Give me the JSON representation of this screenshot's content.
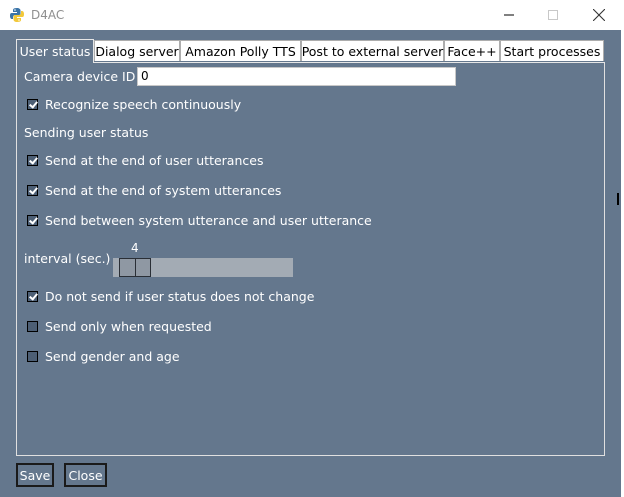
{
  "window": {
    "title": "D4AC"
  },
  "tabs": [
    {
      "label": "User status"
    },
    {
      "label": "Dialog server"
    },
    {
      "label": "Amazon Polly TTS"
    },
    {
      "label": "Post to external server"
    },
    {
      "label": "Face++"
    },
    {
      "label": "Start processes"
    }
  ],
  "user_status": {
    "camera_label": "Camera device ID",
    "camera_value": "0",
    "recognize_label": "Recognize speech continuously",
    "recognize_checked": true,
    "sending_heading": "Sending user status",
    "send_user_end_label": "Send at the end of user utterances",
    "send_user_end_checked": true,
    "send_system_end_label": "Send at the end of system utterances",
    "send_system_end_checked": true,
    "send_between_label": "Send between system utterance and user utterance",
    "send_between_checked": true,
    "interval_label": "interval (sec.)",
    "interval_value": "4",
    "no_change_label": "Do not send if user status does not change",
    "no_change_checked": true,
    "only_requested_label": "Send only when requested",
    "only_requested_checked": false,
    "gender_age_label": "Send gender and age",
    "gender_age_checked": false
  },
  "footer": {
    "save_label": "Save",
    "close_label": "Close"
  },
  "colors": {
    "background": "#64778d",
    "titlebar": "#ffffff",
    "text": "#ffffff"
  },
  "icons": {
    "app": "python-icon",
    "minimize": "minimize-icon",
    "maximize": "maximize-icon",
    "close": "close-icon"
  }
}
